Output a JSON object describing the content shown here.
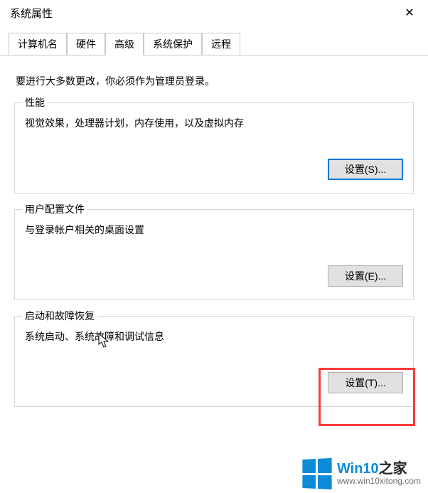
{
  "window": {
    "title": "系统属性",
    "close_glyph": "✕"
  },
  "tabs": {
    "computer_name": "计算机名",
    "hardware": "硬件",
    "advanced": "高级",
    "system_protection": "系统保护",
    "remote": "远程"
  },
  "intro": "要进行大多数更改，你必须作为管理员登录。",
  "groups": {
    "performance": {
      "legend": "性能",
      "desc": "视觉效果，处理器计划，内存使用，以及虚拟内存",
      "button": "设置(S)..."
    },
    "user_profiles": {
      "legend": "用户配置文件",
      "desc": "与登录帐户相关的桌面设置",
      "button": "设置(E)..."
    },
    "startup_recovery": {
      "legend": "启动和故障恢复",
      "desc": "系统启动、系统故障和调试信息",
      "button": "设置(T)..."
    }
  },
  "watermark": {
    "brand_prefix": "Win10",
    "brand_suffix": "之家",
    "url": "www.win10xitong.com"
  }
}
